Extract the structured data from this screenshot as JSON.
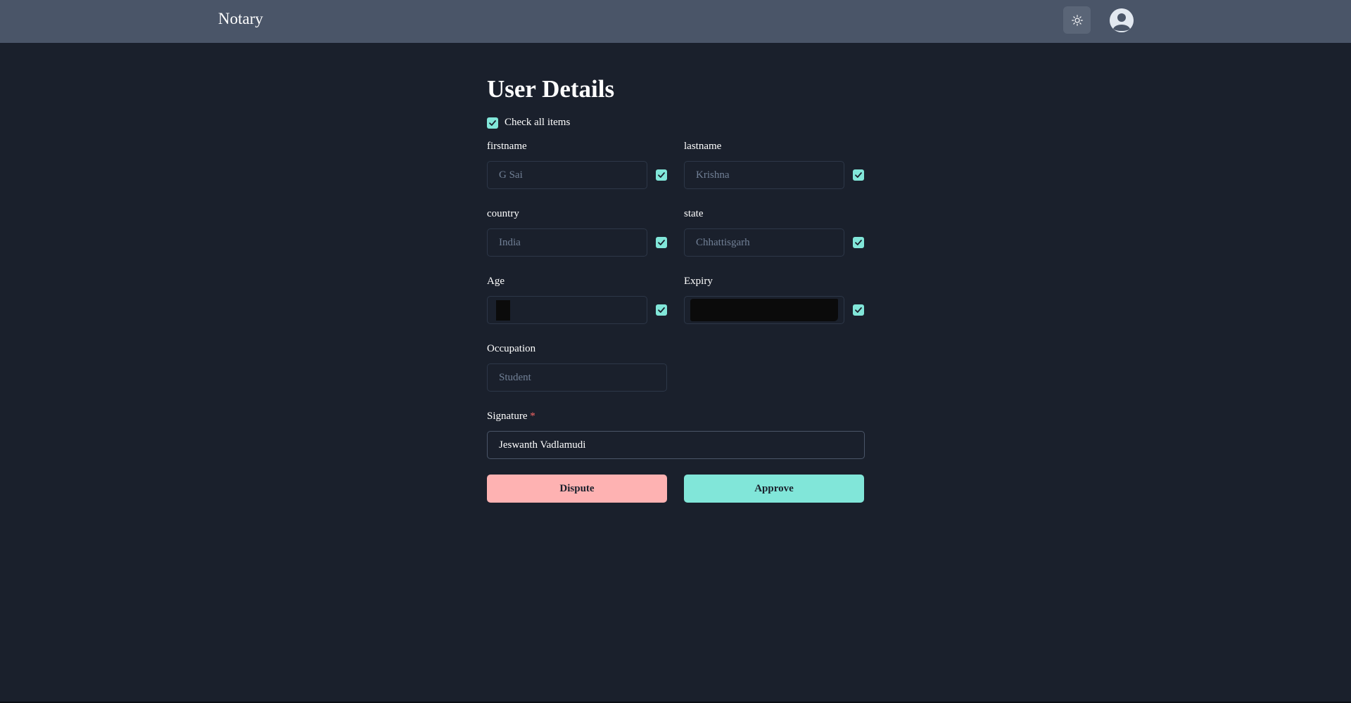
{
  "app": {
    "brand": "Notary",
    "theme_icon": "sun-icon",
    "avatar_icon": "user-avatar-icon"
  },
  "form": {
    "title": "User Details",
    "check_all_label": "Check all items",
    "check_all_checked": true,
    "fields": [
      {
        "label": "firstname",
        "value": "G Sai",
        "checked": true
      },
      {
        "label": "lastname",
        "value": "Krishna",
        "checked": true
      },
      {
        "label": "country",
        "value": "India",
        "checked": true
      },
      {
        "label": "state",
        "value": "Chhattisgarh",
        "checked": true
      },
      {
        "label": "Age",
        "value": "",
        "redacted": true,
        "checked": true
      },
      {
        "label": "Expiry",
        "value": "",
        "redacted": true,
        "checked": true
      },
      {
        "label": "Occupation",
        "value": "Student"
      }
    ],
    "signature": {
      "label": "Signature",
      "required_mark": "*",
      "value": "Jeswanth Vadlamudi"
    },
    "buttons": {
      "dispute": "Dispute",
      "approve": "Approve"
    }
  },
  "colors": {
    "background": "#1a202c",
    "header": "#4a5568",
    "accent_teal": "#81e6d9",
    "dispute_red": "#feb2b2",
    "required_red": "#f56565"
  }
}
